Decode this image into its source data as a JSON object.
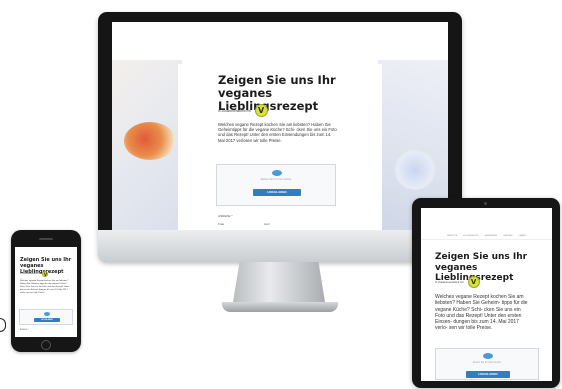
{
  "campaign": {
    "title_line1": "Zeigen Sie uns Ihr",
    "title_line2": "veganes Lieblingsrezept",
    "sponsor_label": "In Zusammenarbeit mit",
    "sponsor_logo_letter": "V",
    "body_imac": "Welches vegane Rezept kochen Sie am liebsten? Haben Sie Geheimtipps für die vegane Küche? Schi- cken Sie uns ein Foto und das Rezept! Unter den ersten Einsendungen bis zum 14. Mai 2017 verlosen wir tolle Preise.",
    "body_ipad": "Welches vegane Rezept kochen Sie am liebsten? Haben Sie Geheim- tipps für die vegane Küche? Schi- cken Sie uns ein Foto und das Rezept! Unter den ersten Einsen- dungen bis zum 14. Mai 2017 verlo- sen wir tolle Preise.",
    "upload_hint": "Ziehen Sie Ihr Foto hierher",
    "upload_button": "HOCHLADEN",
    "form_label": "ANREDE *",
    "radio_1": "Frau",
    "radio_2": "Herr"
  },
  "ipad_nav": [
    "REZEPTE",
    "KOCHSCHULE",
    "GENIESSEN",
    "GESUND",
    "LEBEN"
  ],
  "colors": {
    "accent_blue": "#2f7dc4",
    "sponsor_logo": "#d8e23a",
    "device_frame": "#161616"
  }
}
